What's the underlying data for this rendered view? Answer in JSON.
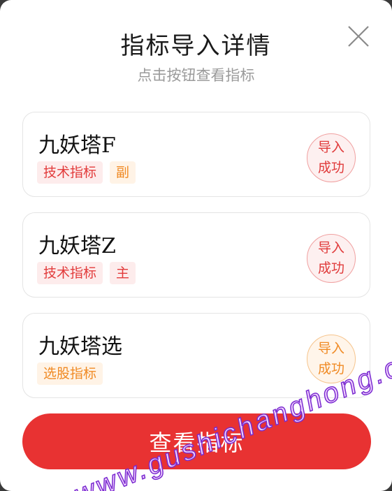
{
  "dialog": {
    "title": "指标导入详情",
    "subtitle": "点击按钮查看指标",
    "close_icon": "close-icon"
  },
  "indicators": [
    {
      "name": "九妖塔F",
      "tags": [
        {
          "label": "技术指标",
          "color": "#e23b3b"
        },
        {
          "label": "副",
          "color": "#f08a24"
        }
      ],
      "status": "导入成功",
      "status_line1": "导入",
      "status_line2": "成功",
      "status_color": "#e03a3a"
    },
    {
      "name": "九妖塔Z",
      "tags": [
        {
          "label": "技术指标",
          "color": "#e23b3b"
        },
        {
          "label": "主",
          "color": "#e23b3b"
        }
      ],
      "status": "导入成功",
      "status_line1": "导入",
      "status_line2": "成功",
      "status_color": "#e03a3a"
    },
    {
      "name": "九妖塔选",
      "tags": [
        {
          "label": "选股指标",
          "color": "#f08a24"
        }
      ],
      "status": "导入成功",
      "status_line1": "导入",
      "status_line2": "成功",
      "status_color": "#f08a24"
    }
  ],
  "primary_button": {
    "label": "查看指标",
    "color": "#e83232"
  },
  "watermark": "www.gushichanghong.com"
}
